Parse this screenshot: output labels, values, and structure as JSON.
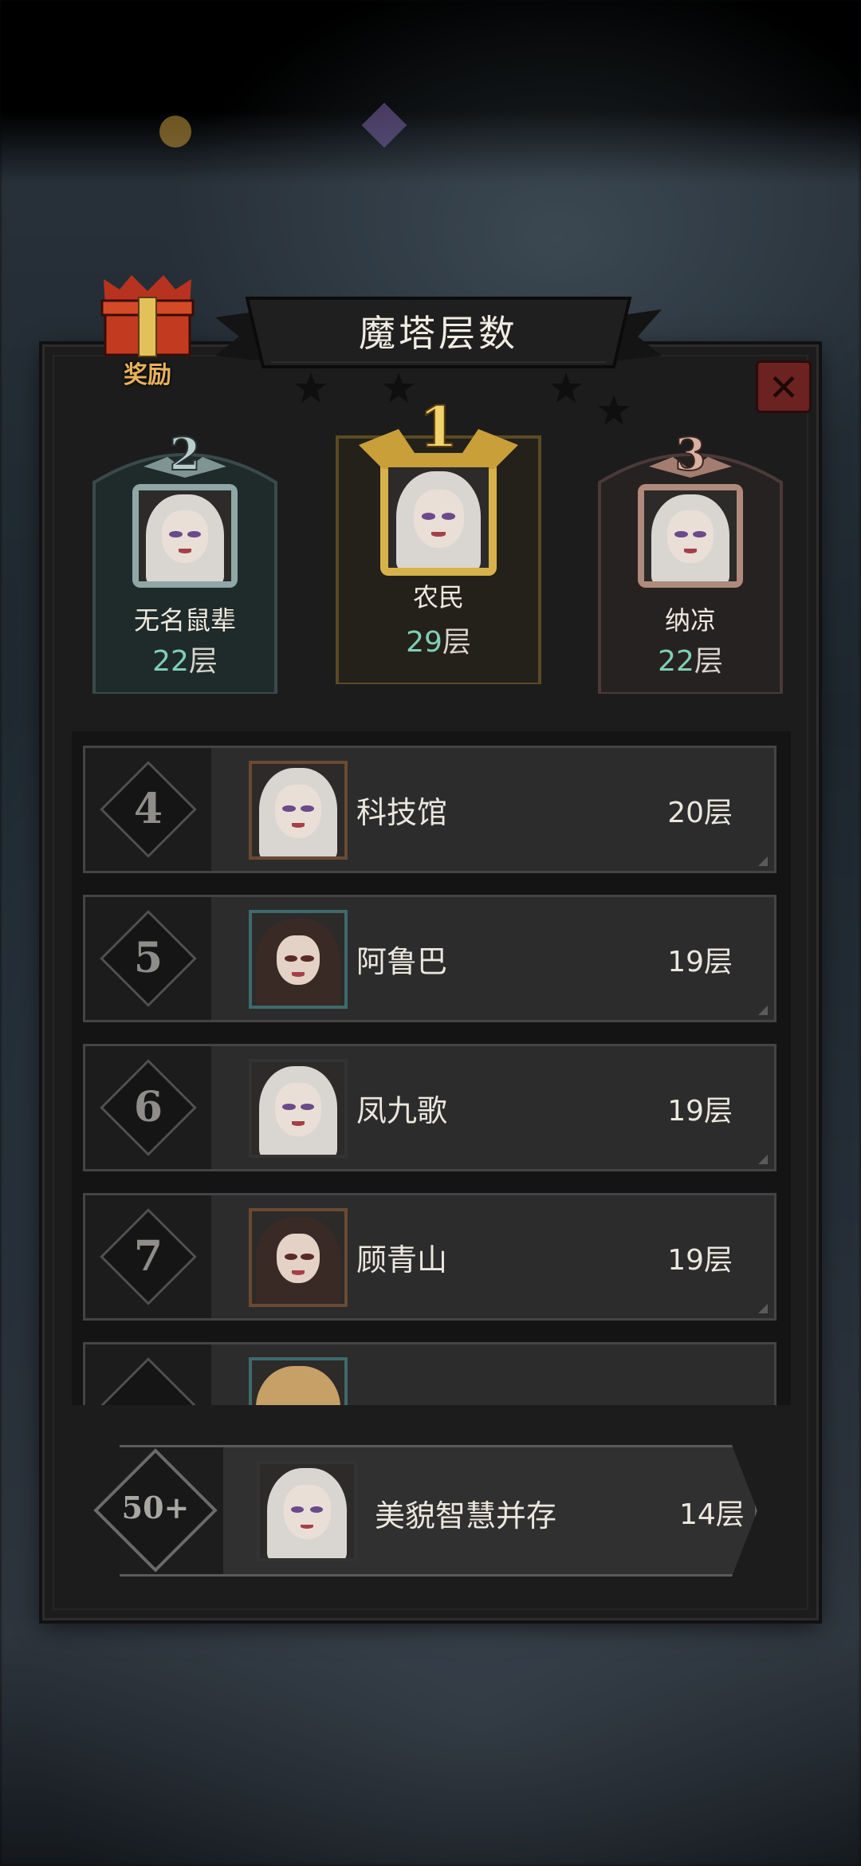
{
  "title": "魔塔层数",
  "reward_label": "奖励",
  "close_label": "✕",
  "podium": [
    {
      "rank": "2",
      "name": "无名鼠辈",
      "score": "22",
      "unit": "层"
    },
    {
      "rank": "1",
      "name": "农民",
      "score": "29",
      "unit": "层"
    },
    {
      "rank": "3",
      "name": "纳凉",
      "score": "22",
      "unit": "层"
    }
  ],
  "rows": [
    {
      "rank": "4",
      "name": "科技馆",
      "score": "20层"
    },
    {
      "rank": "5",
      "name": "阿鲁巴",
      "score": "19层"
    },
    {
      "rank": "6",
      "name": "凤九歌",
      "score": "19层"
    },
    {
      "rank": "7",
      "name": "顾青山",
      "score": "19层"
    }
  ],
  "self": {
    "rank": "50+",
    "name": "美貌智慧并存",
    "score": "14层"
  },
  "colors": {
    "gold": "#d7b24a",
    "silver": "#8fa7a5",
    "bronze": "#b08a7c",
    "score_accent": "#7fcfb6",
    "close_red": "#6b2220"
  }
}
